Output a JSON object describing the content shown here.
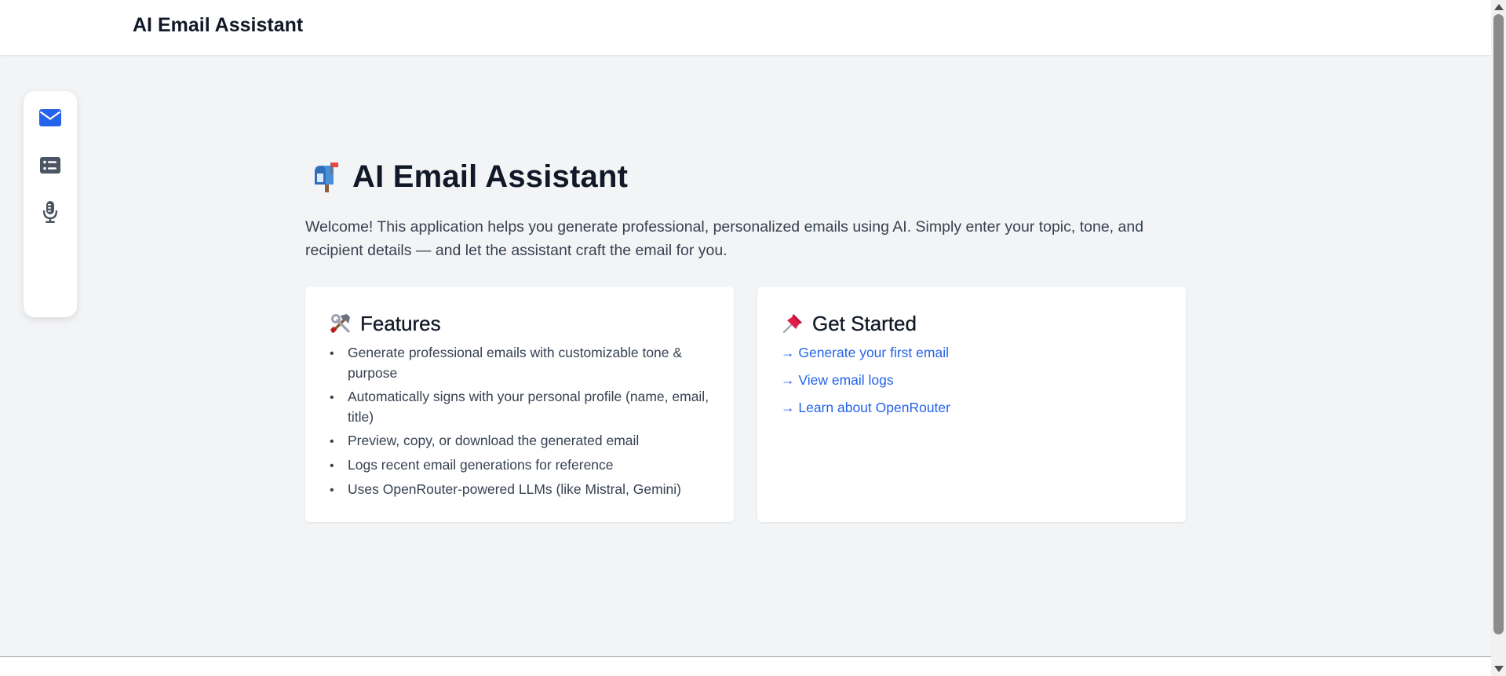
{
  "header": {
    "brand": "AI Email Assistant"
  },
  "sidebar": {
    "items": [
      {
        "icon": "envelope-icon",
        "active": true,
        "color": "#2563eb"
      },
      {
        "icon": "list-card-icon",
        "active": false,
        "color": "#4b5563"
      },
      {
        "icon": "microphone-icon",
        "active": false,
        "color": "#4b5563"
      }
    ]
  },
  "main": {
    "title_icon": "mailbox-emoji-icon",
    "title": "AI Email Assistant",
    "welcome": "Welcome! This application helps you generate professional, personalized emails using AI. Simply enter your topic, tone, and recipient details — and let the assistant craft the email for you."
  },
  "features_card": {
    "icon": "hammer-wrench-emoji-icon",
    "title": "Features",
    "bullet": "•",
    "items": [
      "Generate professional emails with customizable tone & purpose",
      "Automatically signs with your personal profile (name, email, title)",
      "Preview, copy, or download the generated email",
      "Logs recent email generations for reference",
      "Uses OpenRouter-powered LLMs (like Mistral, Gemini)"
    ]
  },
  "get_started_card": {
    "icon": "pushpin-emoji-icon",
    "title": "Get Started",
    "links": [
      "→ Generate your first email",
      "→ View email logs",
      "→ Learn about OpenRouter"
    ]
  },
  "colors": {
    "accent": "#2563eb",
    "background": "#f3f4f6",
    "card": "#ffffff",
    "text": "#111827",
    "muted_text": "#374151"
  }
}
